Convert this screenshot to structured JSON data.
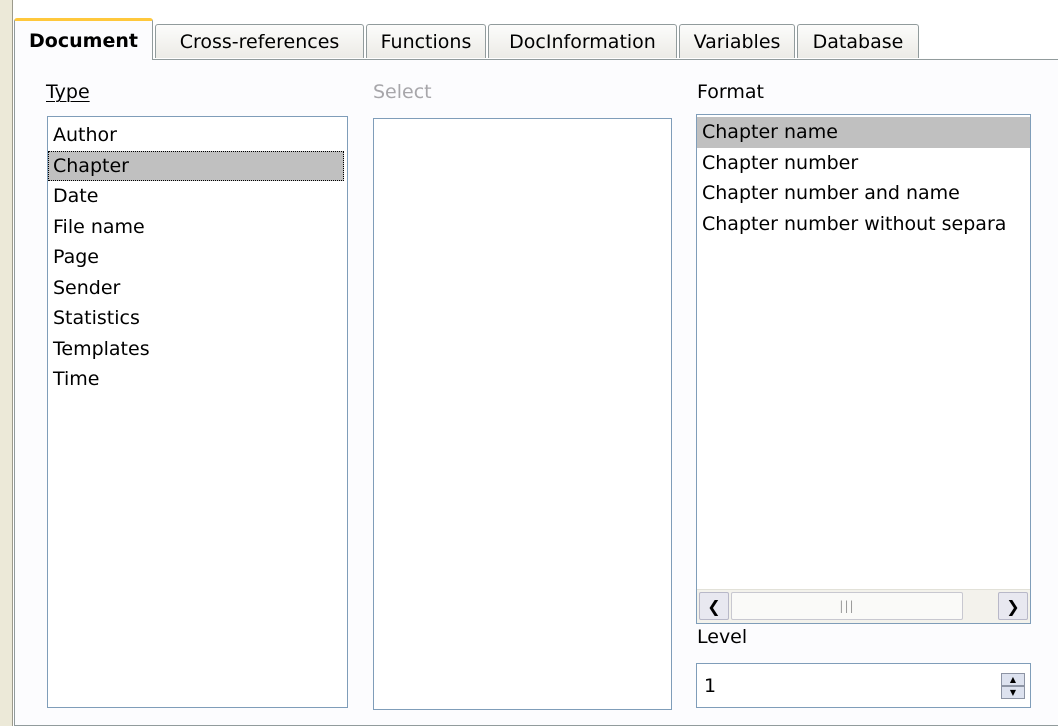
{
  "tabs": [
    {
      "label": "Document",
      "active": true
    },
    {
      "label": "Cross-references",
      "active": false
    },
    {
      "label": "Functions",
      "active": false
    },
    {
      "label": "DocInformation",
      "active": false
    },
    {
      "label": "Variables",
      "active": false
    },
    {
      "label": "Database",
      "active": false
    }
  ],
  "type_section": {
    "label": "Type",
    "items": [
      "Author",
      "Chapter",
      "Date",
      "File name",
      "Page",
      "Sender",
      "Statistics",
      "Templates",
      "Time"
    ],
    "selected": "Chapter"
  },
  "select_section": {
    "label": "Select",
    "enabled": false,
    "items": []
  },
  "format_section": {
    "label": "Format",
    "items": [
      "Chapter name",
      "Chapter number",
      "Chapter number and name",
      "Chapter number without separa"
    ],
    "selected": "Chapter name",
    "scroll_left_icon": "chevron-left-icon",
    "scroll_right_icon": "chevron-right-icon",
    "scroll_grip_icon": "grip-icon"
  },
  "level_section": {
    "label": "Level",
    "value": "1",
    "spin_icons": [
      "chevron-up-icon",
      "chevron-down-icon"
    ]
  },
  "colors": {
    "selection": "#c0c0c0",
    "active_tab_accent": "#ffc83c",
    "listbox_border": "#7f9db9",
    "disabled_text": "#a7a6aa"
  }
}
